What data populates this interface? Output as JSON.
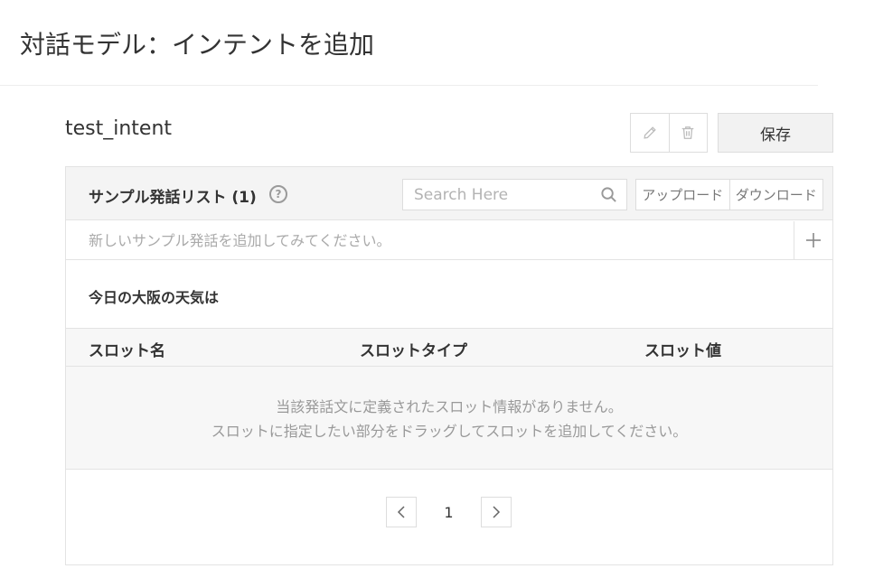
{
  "page": {
    "title": "対話モデル：インテントを追加"
  },
  "intent": {
    "name": "test_intent"
  },
  "toolbar": {
    "save_label": "保存"
  },
  "sample_list": {
    "title": "サンプル発話リスト (1)",
    "help_glyph": "?",
    "search_placeholder": "Search Here",
    "upload_label": "アップロード",
    "download_label": "ダウンロード",
    "add_placeholder": "新しいサンプル発話を追加してみてください。",
    "utterance": "今日の大阪の天気は"
  },
  "slots": {
    "columns": [
      "スロット名",
      "スロットタイプ",
      "スロット値"
    ],
    "empty_line1": "当該発話文に定義されたスロット情報がありません。",
    "empty_line2": "スロットに指定したい部分をドラッグしてスロットを追加してください。"
  },
  "pagination": {
    "current_page": "1"
  }
}
